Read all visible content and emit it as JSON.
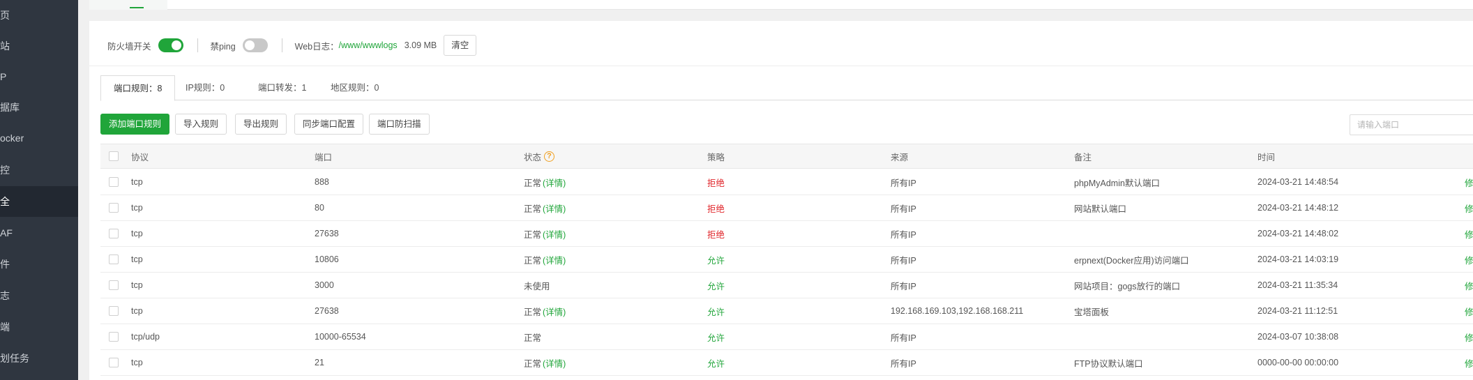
{
  "sidebar": {
    "items": [
      {
        "label": "页",
        "active": false
      },
      {
        "label": "站",
        "active": false
      },
      {
        "label": "P",
        "active": false
      },
      {
        "label": "据库",
        "active": false
      },
      {
        "label": "ocker",
        "active": false
      },
      {
        "label": "控",
        "active": false
      },
      {
        "label": "全",
        "active": true
      },
      {
        "label": "AF",
        "active": false
      },
      {
        "label": "件",
        "active": false
      },
      {
        "label": "志",
        "active": false
      },
      {
        "label": "端",
        "active": false
      },
      {
        "label": "划任务",
        "active": false
      }
    ]
  },
  "toolbar": {
    "firewall_label": "防火墙开关",
    "firewall_on": true,
    "ping_label": "禁ping",
    "ping_on": false,
    "weblog_label": "Web日志：",
    "weblog_path": "/www/wwwlogs",
    "weblog_size": "3.09 MB",
    "clear_label": "清空"
  },
  "tabs": [
    {
      "label": "端口规则：8",
      "active": true
    },
    {
      "label": "IP规则：0",
      "active": false
    },
    {
      "label": "端口转发：1",
      "active": false
    },
    {
      "label": "地区规则：0",
      "active": false
    }
  ],
  "actions": {
    "add": "添加端口规则",
    "import": "导入规则",
    "export": "导出规则",
    "sync": "同步端口配置",
    "scan": "端口防扫描",
    "search_placeholder": "请输入端口"
  },
  "table": {
    "headers": {
      "protocol": "协议",
      "port": "端口",
      "status": "状态",
      "status_help": "?",
      "policy": "策略",
      "source": "来源",
      "remark": "备注",
      "time": "时间"
    },
    "rows": [
      {
        "protocol": "tcp",
        "port": "888",
        "status": "正常",
        "detail": "(详情)",
        "policy": "拒绝",
        "policy_type": "deny",
        "source": "所有IP",
        "remark": "phpMyAdmin默认端口",
        "time": "2024-03-21 14:48:54",
        "op": "修改"
      },
      {
        "protocol": "tcp",
        "port": "80",
        "status": "正常",
        "detail": "(详情)",
        "policy": "拒绝",
        "policy_type": "deny",
        "source": "所有IP",
        "remark": "网站默认端口",
        "time": "2024-03-21 14:48:12",
        "op": "修改"
      },
      {
        "protocol": "tcp",
        "port": "27638",
        "status": "正常",
        "detail": "(详情)",
        "policy": "拒绝",
        "policy_type": "deny",
        "source": "所有IP",
        "remark": "",
        "time": "2024-03-21 14:48:02",
        "op": "修改"
      },
      {
        "protocol": "tcp",
        "port": "10806",
        "status": "正常",
        "detail": "(详情)",
        "policy": "允许",
        "policy_type": "allow",
        "source": "所有IP",
        "remark": "erpnext(Docker应用)访问端口",
        "time": "2024-03-21 14:03:19",
        "op": "修改"
      },
      {
        "protocol": "tcp",
        "port": "3000",
        "status": "未使用",
        "detail": "",
        "policy": "允许",
        "policy_type": "allow",
        "source": "所有IP",
        "remark": "网站项目：gogs放行的端口",
        "time": "2024-03-21 11:35:34",
        "op": "修改"
      },
      {
        "protocol": "tcp",
        "port": "27638",
        "status": "正常",
        "detail": "(详情)",
        "policy": "允许",
        "policy_type": "allow",
        "source": "192.168.169.103,192.168.168.211",
        "remark": "宝塔面板",
        "time": "2024-03-21 11:12:51",
        "op": "修改"
      },
      {
        "protocol": "tcp/udp",
        "port": "10000-65534",
        "status": "正常",
        "detail": "",
        "policy": "允许",
        "policy_type": "allow",
        "source": "所有IP",
        "remark": "",
        "time": "2024-03-07 10:38:08",
        "op": "修改"
      },
      {
        "protocol": "tcp",
        "port": "21",
        "status": "正常",
        "detail": "(详情)",
        "policy": "允许",
        "policy_type": "allow",
        "source": "所有IP",
        "remark": "FTP协议默认端口",
        "time": "0000-00-00 00:00:00",
        "op": "修改"
      }
    ]
  }
}
